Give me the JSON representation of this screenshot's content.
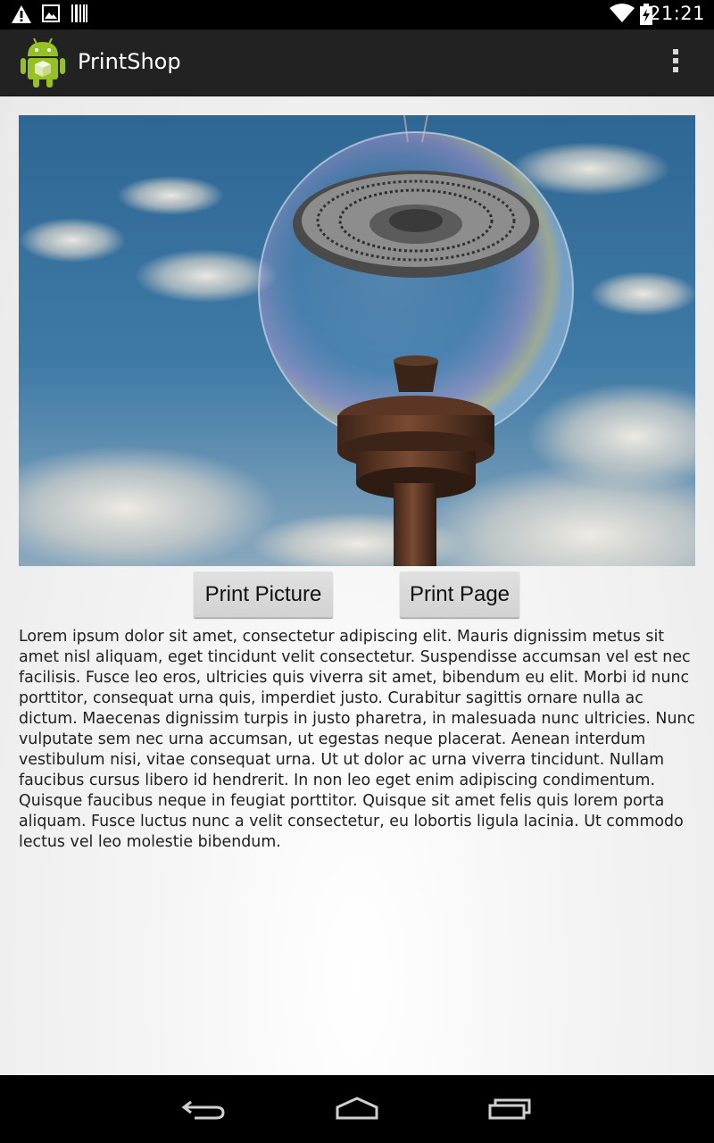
{
  "status_bar": {
    "time": "21:21",
    "icons": [
      "warning-icon",
      "image-notification-icon",
      "barcode-icon",
      "wifi-icon",
      "battery-charging-icon"
    ]
  },
  "action_bar": {
    "title": "PrintShop",
    "app_icon": "android-robot-icon",
    "menu_icon": "overflow-menu-icon"
  },
  "main": {
    "print_picture_label": "Print Picture",
    "print_page_label": "Print Page",
    "body_text": "Lorem ipsum dolor sit amet, consectetur adipiscing elit. Mauris dignissim metus sit amet nisl aliquam, eget tincidunt velit consectetur. Suspendisse accumsan vel est nec facilisis. Fusce leo eros, ultricies quis viverra sit amet, bibendum eu elit. Morbi id nunc porttitor, consequat urna quis, imperdiet justo. Curabitur sagittis ornare nulla ac dictum. Maecenas dignissim turpis in justo pharetra, in malesuada nunc ultricies. Nunc vulputate sem nec urna accumsan, ut egestas neque placerat. Aenean interdum vestibulum nisi, vitae consequat urna. Ut ut dolor ac urna viverra tincidunt. Nullam faucibus cursus libero id hendrerit. In non leo eget enim adipiscing condimentum. Quisque faucibus neque in feugiat porttitor. Quisque sit amet felis quis lorem porta aliquam. Fusce luctus nunc a velit consectetur, eu lobortis ligula lacinia. Ut commodo lectus vel leo molestie bibendum."
  },
  "nav_bar": {
    "icons": [
      "back-icon",
      "home-icon",
      "recent-apps-icon"
    ]
  },
  "colors": {
    "action_bar": "#222222",
    "content_background": "#eeeeee",
    "button": "#d6d6d6",
    "android_green": "#97c024"
  }
}
